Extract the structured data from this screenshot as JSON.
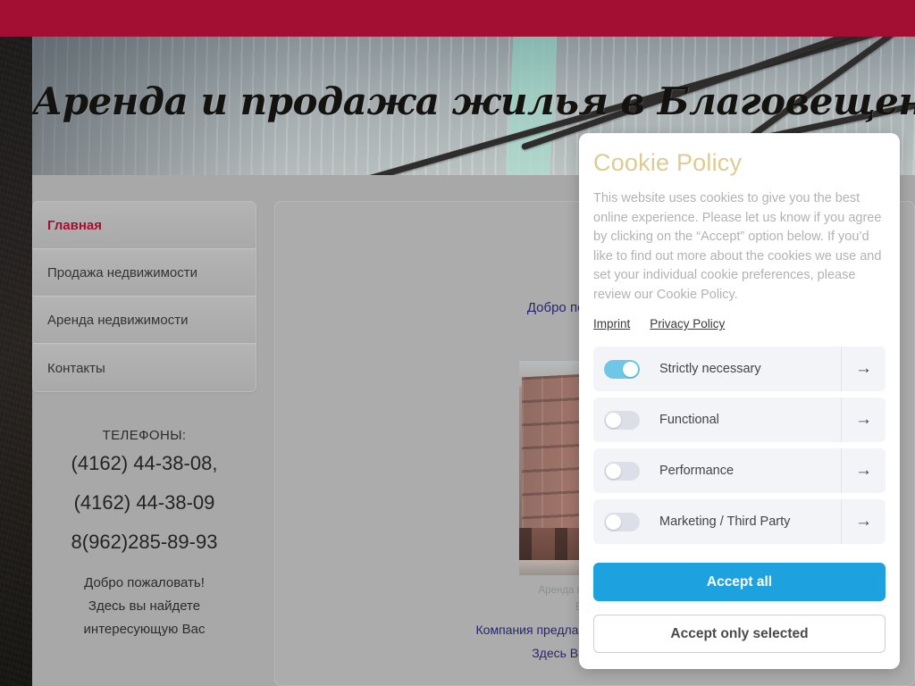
{
  "site": {
    "banner_title": "Аренда и продажа жилья в Благовещенске",
    "top_bar_color": "#a30f33"
  },
  "sidebar": {
    "nav_items": [
      {
        "label": "Главная",
        "active": true
      },
      {
        "label": "Продажа недвижимости",
        "active": false
      },
      {
        "label": "Аренда недвижимости",
        "active": false
      },
      {
        "label": "Контакты",
        "active": false
      }
    ],
    "phones_label": "ТЕЛЕФОНЫ:",
    "phones": [
      "(4162) 44-38-08,",
      "(4162) 44-38-09",
      "8(962)285-89-93"
    ],
    "welcome_lines": [
      "Добро пожаловать!",
      "Здесь вы найдете",
      "интересующую Вас"
    ]
  },
  "main": {
    "welcome_heading": "Добро пожаловать на",
    "figure_caption_line1": "Аренда квартир, купить",
    "figure_caption_line2": "Благове",
    "paragraph_line1": "Компания предлагает к продаже и аренд",
    "paragraph_line2": "Здесь Вы найдете то,"
  },
  "cookie_dialog": {
    "title": "Cookie Policy",
    "body": "This website uses cookies to give you the best online experience. Please let us know if you agree by clicking on the “Accept” option below. If you’d like to find out more about the cookies we use and set your individual cookie preferences, please review our Cookie Policy.",
    "links": [
      {
        "label": "Imprint"
      },
      {
        "label": "Privacy Policy"
      }
    ],
    "consent_rows": [
      {
        "label": "Strictly necessary",
        "enabled": true
      },
      {
        "label": "Functional",
        "enabled": false
      },
      {
        "label": "Performance",
        "enabled": false
      },
      {
        "label": "Marketing / Third Party",
        "enabled": false
      }
    ],
    "arrow_glyph": "→",
    "accept_all_label": "Accept all",
    "accept_selected_label": "Accept only selected",
    "accent_color": "#1ea2df",
    "title_color": "#ddcb94",
    "toggle_on_color": "#6fc7e8"
  }
}
